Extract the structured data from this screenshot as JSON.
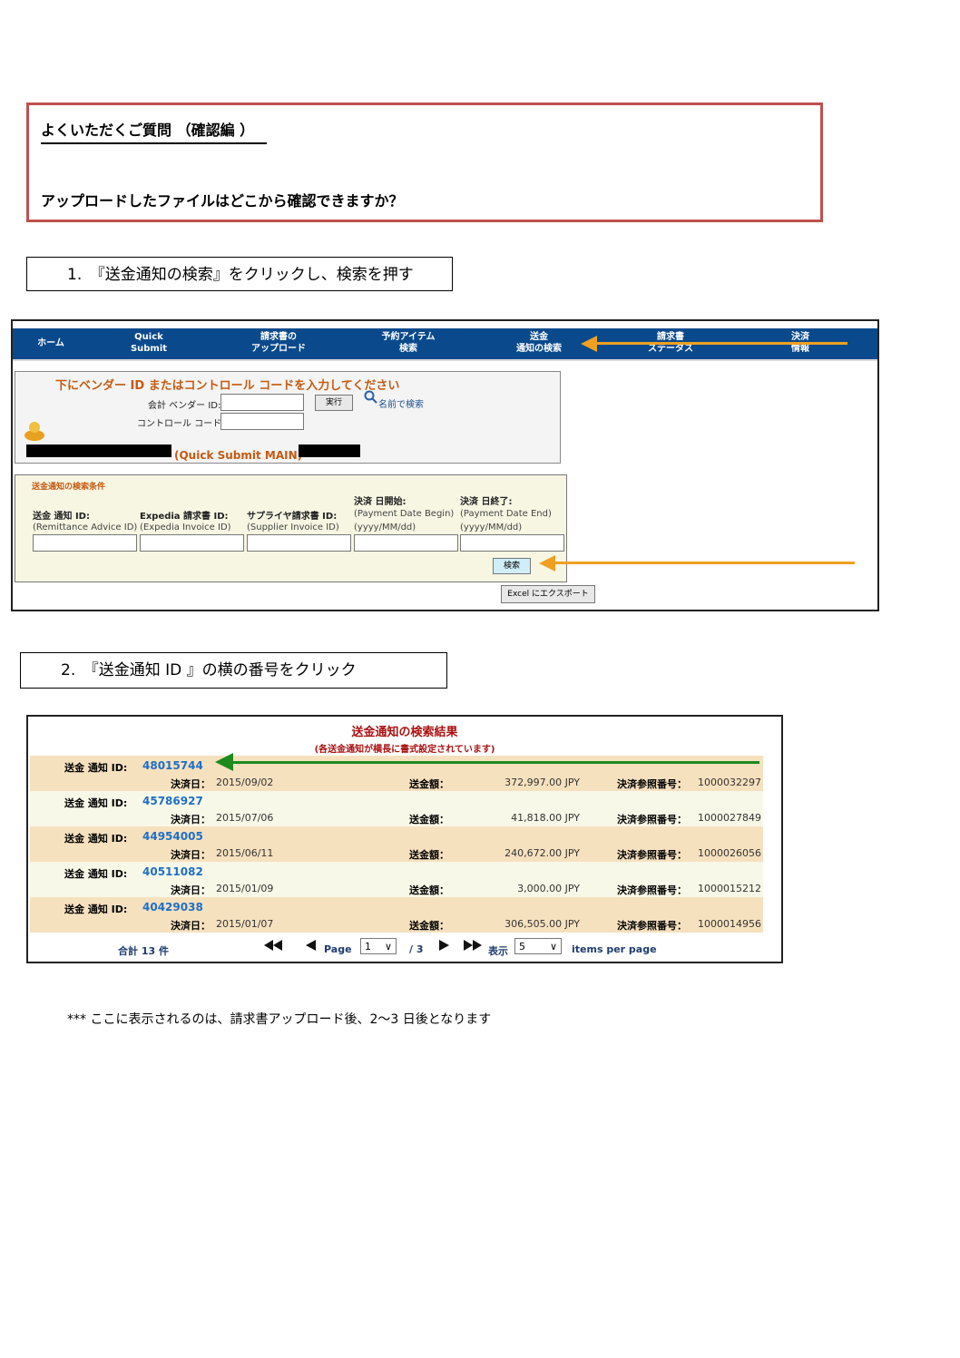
{
  "faq": {
    "title": "よくいただくご質問 （確認編 ）",
    "question": "アップロードしたファイルはどこから確認できますか？"
  },
  "steps": [
    "1.　『送金通知の検索』をクリックし、検索を押す",
    "2.　『送金通知 ID 』の横の番号をクリック"
  ],
  "nav": {
    "items": [
      {
        "label": "ホーム"
      },
      {
        "label": "Quick\nSubmit"
      },
      {
        "label": "請求書の\nアップロード"
      },
      {
        "label": "予約アイテム\n検索"
      },
      {
        "label": "送金\n通知の検索"
      },
      {
        "label": "請求書\nステータス"
      },
      {
        "label": "決済\n情報"
      }
    ],
    "bar_color": "#0a4a8c"
  },
  "vendor_form": {
    "heading": "下にベンダー ID またはコントロール コードを入力してください",
    "vendor_label": "会計 ベンダー ID:",
    "control_label": "コントロール コード:",
    "exec_button": "実行",
    "name_search": "名前で検索",
    "quick_submit": "(Quick Submit MAIN)"
  },
  "criteria": {
    "title": "送金通知の検索条件",
    "columns": [
      {
        "jp": "送金 通知 ID:",
        "en": "(Remittance Advice ID)",
        "top": ""
      },
      {
        "jp": "Expedia 請求書 ID:",
        "en": "(Expedia Invoice ID)",
        "top": ""
      },
      {
        "jp": "サプライヤ請求書 ID:",
        "en": "(Supplier Invoice ID)",
        "top": ""
      },
      {
        "jp": "(Payment Date Begin)",
        "en": "(yyyy/MM/dd)",
        "top": "決済 日開始:"
      },
      {
        "jp": "(Payment Date End)",
        "en": "(yyyy/MM/dd)",
        "top": "決済 日終了:"
      }
    ],
    "search_button": "検索",
    "excel_button": "Excel にエクスポート"
  },
  "results": {
    "title": "送金通知の検索結果",
    "subtitle": "(各送金通知が横長に書式設定されています)",
    "id_label": "送金 通知 ID:",
    "date_label": "決済日：",
    "amount_label": "送金額：",
    "ref_label": "決済参照番号：",
    "rows": [
      {
        "id": "48015744",
        "date": "2015/09/02",
        "amount": "372,997.00  JPY",
        "ref": "1000032297"
      },
      {
        "id": "45786927",
        "date": "2015/07/06",
        "amount": "41,818.00  JPY",
        "ref": "1000027849"
      },
      {
        "id": "44954005",
        "date": "2015/06/11",
        "amount": "240,672.00  JPY",
        "ref": "1000026056"
      },
      {
        "id": "40511082",
        "date": "2015/01/09",
        "amount": "3,000.00  JPY",
        "ref": "1000015212"
      },
      {
        "id": "40429038",
        "date": "2015/01/07",
        "amount": "306,505.00  JPY",
        "ref": "1000014956"
      }
    ],
    "pager": {
      "total": "合計 13 件",
      "page_label": "Page",
      "page_value": "1",
      "page_total": "/ 3",
      "show_label": "表示",
      "per_page_value": "5",
      "items_per_page": "items per page"
    }
  },
  "note": "*** ここに表示されるのは、請求書アップロード後、2～3 日後となります",
  "colors": {
    "accent_orange": "#f0a020",
    "accent_green": "#1e8a1e",
    "faq_border": "#c0504d"
  }
}
